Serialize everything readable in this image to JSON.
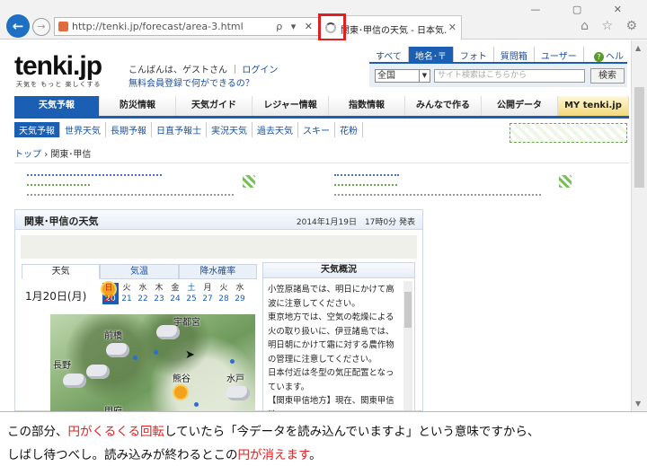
{
  "browser": {
    "url": "http://tenki.jp/forecast/area-3.html",
    "address_controls": "ρ ▾ ✕",
    "tab_title": "関東･甲信の天気 - 日本気…",
    "tab_close": "✕",
    "back": "←",
    "forward": "→",
    "window_controls": "—  ▢  ✕",
    "toolbar_icons": "⌂ ☆ ⚙"
  },
  "site": {
    "logo": "tenki.jp",
    "tagline": "天気を もっと 楽しくする",
    "greeting": "こんばんは、ゲストさん",
    "divider": "｜",
    "login": "ログイン",
    "register": "無料会員登録で何ができるの？",
    "help": "ヘルプ",
    "help_icon": "?"
  },
  "util_links": [
    "すべて",
    "地名･〒",
    "フォト",
    "質問箱",
    "ユーザー"
  ],
  "search": {
    "scope": "全国",
    "placeholder": "サイト検索はこちらから",
    "button": "検索"
  },
  "main_nav": [
    "天気予報",
    "防災情報",
    "天気ガイド",
    "レジャー情報",
    "指数情報",
    "みんなで作る",
    "公開データ",
    "MY tenki.jp"
  ],
  "sub_nav": [
    "天気予報",
    "世界天気",
    "長期予報",
    "日直予報士",
    "実況天気",
    "過去天気",
    "スキー",
    "花粉"
  ],
  "breadcrumb": {
    "top": "トップ",
    "sep": "›",
    "current": "関東･甲信"
  },
  "panel": {
    "title": "関東･甲信の天気",
    "issued": "2014年1月19日　17時0分 発表"
  },
  "forecast": {
    "tabs": [
      "天気",
      "気温",
      "降水確率"
    ],
    "date": "1月20日(月)",
    "days": [
      {
        "wd": "月",
        "d": "20",
        "type": "active"
      },
      {
        "wd": "火",
        "d": "21",
        "type": ""
      },
      {
        "wd": "水",
        "d": "22",
        "type": ""
      },
      {
        "wd": "木",
        "d": "23",
        "type": ""
      },
      {
        "wd": "金",
        "d": "24",
        "type": ""
      },
      {
        "wd": "土",
        "d": "25",
        "type": "sat"
      },
      {
        "wd": "日",
        "d": "26",
        "type": "sun"
      },
      {
        "wd": "月",
        "d": "27",
        "type": ""
      },
      {
        "wd": "火",
        "d": "28",
        "type": ""
      },
      {
        "wd": "水",
        "d": "29",
        "type": ""
      }
    ],
    "cities": [
      "宇都宮",
      "前橋",
      "長野",
      "熊谷",
      "水戸",
      "甲府"
    ]
  },
  "gaikyo": {
    "title": "天気概況",
    "lines": [
      "小笠原諸島では、明日にかけて高",
      "波に注意してください。",
      "東京地方では、空気の乾燥による",
      "火の取り扱いに、伊豆諸島では、",
      "明日朝にかけて霜に対する農作物",
      "の管理に注意してください。",
      "日本付近は冬型の気圧配置となっ",
      "ています。",
      "【関東甲信地方】現在、関東甲信地",
      "方は、おおむね晴れていますが、"
    ]
  },
  "caption": {
    "line1_a": "この部分、",
    "line1_red1": "円がくるくる回転",
    "line1_b": "していたら「今データを読み込んでいますよ」という意味ですから、",
    "line2_a": "しばし待つべし。読み込みが終わるとこの",
    "line2_red": "円が消えます",
    "line2_b": "。"
  }
}
